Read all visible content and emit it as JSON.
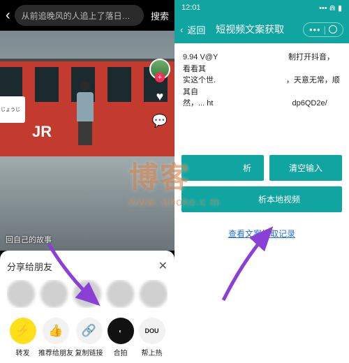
{
  "left": {
    "search_text": "从前追晚风的人追上了落日…",
    "search_btn": "搜索",
    "sign_top": "じょうじ",
    "jr": "JR",
    "caption": "回自己的故事",
    "sheet_title": "分享给朋友",
    "actions": [
      {
        "label": "转发"
      },
      {
        "label": "推荐给朋友"
      },
      {
        "label": "复制链接"
      },
      {
        "label": "合拍"
      },
      {
        "label": "帮上热"
      }
    ]
  },
  "right": {
    "time": "12:01",
    "back": "返回",
    "title": "短视频文案获取",
    "textarea": "9.94 V@Y                                 制打开抖音，看看其\n实这个世.                                 ，天意无常，顺其自\n然，... ht                                     dp6QD2e/",
    "btn_parse": "析",
    "btn_clear": "清空输入",
    "btn_local": "析本地视频",
    "link": "查看文案提取记录"
  },
  "watermark": "博客",
  "watermark_sub": "www.        uboke.c   m"
}
